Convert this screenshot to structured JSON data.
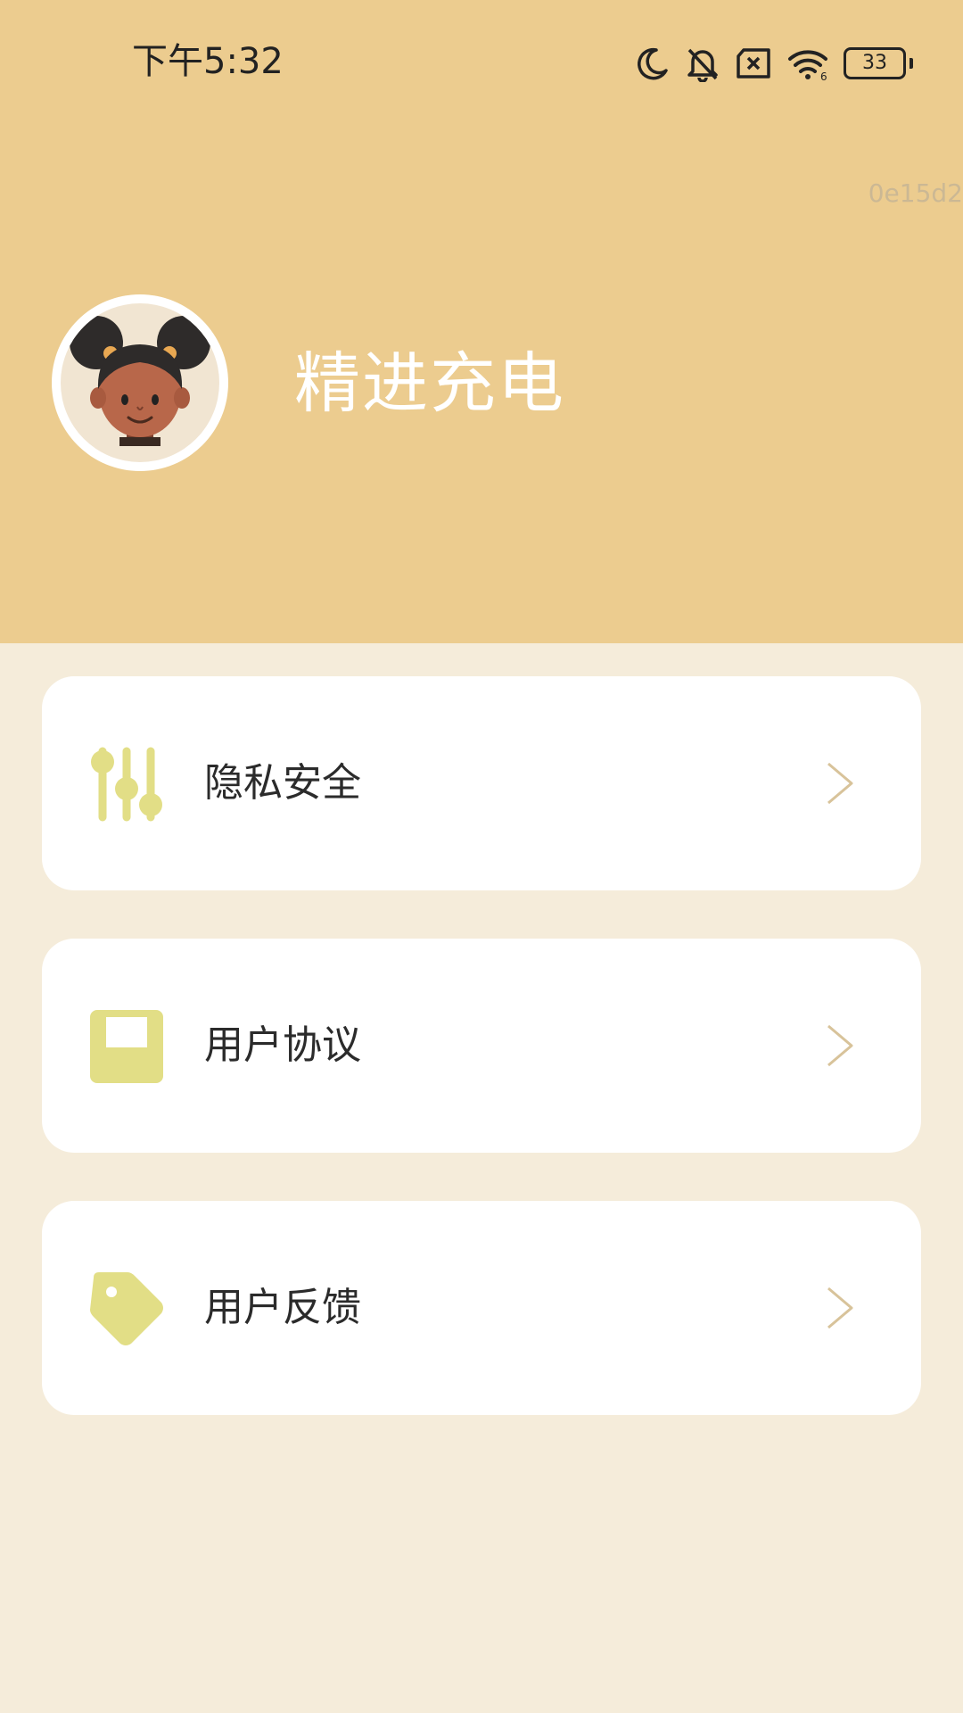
{
  "status_bar": {
    "time": "下午5:32",
    "battery_level": "33",
    "icons": [
      "moon-icon",
      "bell-off-icon",
      "sim-error-icon",
      "wifi-icon",
      "battery-icon"
    ]
  },
  "header": {
    "build_tag": "0e15d2",
    "profile_name": "精进充电",
    "avatar": "girl-avatar"
  },
  "menu": {
    "items": [
      {
        "label": "隐私安全",
        "icon": "sliders-icon"
      },
      {
        "label": "用户协议",
        "icon": "document-icon"
      },
      {
        "label": "用户反馈",
        "icon": "tag-icon"
      }
    ]
  },
  "colors": {
    "header_bg": "#eccc8f",
    "page_bg": "#f5ecda",
    "card_bg": "#ffffff",
    "icon_accent": "#e2de86",
    "chevron": "#d8c39a"
  }
}
